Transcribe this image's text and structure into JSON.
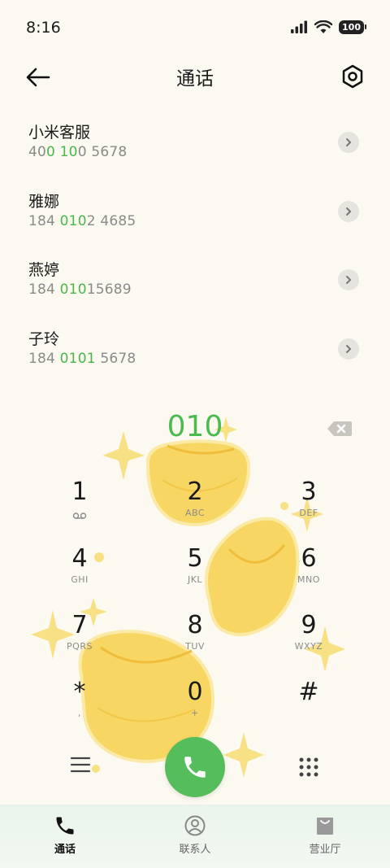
{
  "status": {
    "time": "8:16",
    "battery": "100"
  },
  "header": {
    "title": "通话"
  },
  "contacts": [
    {
      "name": "小米客服",
      "number_parts": [
        "40",
        "0 10",
        "0 5678"
      ]
    },
    {
      "name": "雅娜",
      "number_parts": [
        "184 ",
        "010",
        "2 4685"
      ]
    },
    {
      "name": "燕婷",
      "number_parts": [
        "184 ",
        "010",
        "15689"
      ]
    },
    {
      "name": "子玲",
      "number_parts": [
        "184 ",
        "0101",
        " 5678"
      ]
    }
  ],
  "dialer": {
    "input": "010",
    "keys": [
      {
        "digit": "1",
        "letters": ""
      },
      {
        "digit": "2",
        "letters": "ABC"
      },
      {
        "digit": "3",
        "letters": "DEF"
      },
      {
        "digit": "4",
        "letters": "GHI"
      },
      {
        "digit": "5",
        "letters": "JKL"
      },
      {
        "digit": "6",
        "letters": "MNO"
      },
      {
        "digit": "7",
        "letters": "PQRS"
      },
      {
        "digit": "8",
        "letters": "TUV"
      },
      {
        "digit": "9",
        "letters": "WXYZ"
      },
      {
        "digit": "*",
        "letters": ","
      },
      {
        "digit": "0",
        "letters": "+"
      },
      {
        "digit": "#",
        "letters": ""
      }
    ]
  },
  "bottom_nav": [
    {
      "label": "通话",
      "icon": "phone-icon",
      "active": true
    },
    {
      "label": "联系人",
      "icon": "contacts-icon",
      "active": false
    },
    {
      "label": "营业厅",
      "icon": "shopping-bag-icon",
      "active": false
    }
  ],
  "colors": {
    "accent": "#4cbb4f",
    "background": "#fcf9f0",
    "call_button": "#55bd5c"
  }
}
